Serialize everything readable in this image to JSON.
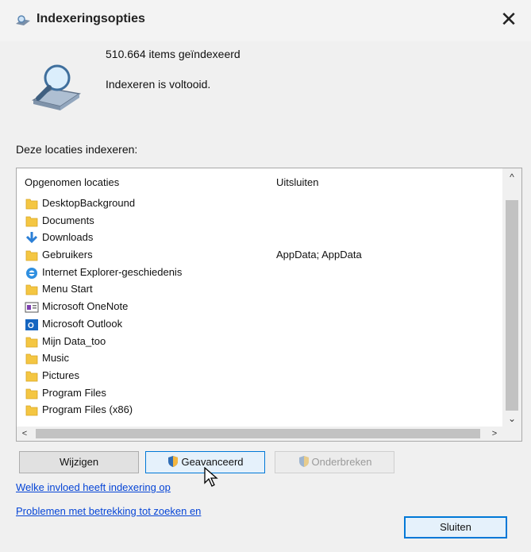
{
  "window": {
    "title": "Indexeringsopties",
    "close_glyph": "✕"
  },
  "summary": {
    "items_indexed": "510.664 items geïndexeerd",
    "status": "Indexeren is voltooid."
  },
  "locations_label": "Deze locaties indexeren:",
  "table": {
    "columns": [
      "Opgenomen locaties",
      "Uitsluiten"
    ],
    "rows": [
      {
        "name": "DesktopBackground",
        "exclude": "",
        "icon": "folder-icon"
      },
      {
        "name": "Documents",
        "exclude": "",
        "icon": "folder-icon"
      },
      {
        "name": "Downloads",
        "exclude": "",
        "icon": "download-arrow-icon"
      },
      {
        "name": "Gebruikers",
        "exclude": "AppData; AppData",
        "icon": "folder-icon"
      },
      {
        "name": "Internet Explorer-geschiedenis",
        "exclude": "",
        "icon": "internet-explorer-icon"
      },
      {
        "name": "Menu Start",
        "exclude": "",
        "icon": "folder-icon"
      },
      {
        "name": "Microsoft OneNote",
        "exclude": "",
        "icon": "onenote-icon"
      },
      {
        "name": "Microsoft Outlook",
        "exclude": "",
        "icon": "outlook-icon"
      },
      {
        "name": "Mijn Data_too",
        "exclude": "",
        "icon": "folder-icon"
      },
      {
        "name": "Music",
        "exclude": "",
        "icon": "folder-icon"
      },
      {
        "name": "Pictures",
        "exclude": "",
        "icon": "folder-icon"
      },
      {
        "name": "Program Files",
        "exclude": "",
        "icon": "folder-icon"
      },
      {
        "name": "Program Files (x86)",
        "exclude": "",
        "icon": "folder-icon"
      }
    ]
  },
  "scroll_glyphs": {
    "up": "^",
    "down": "⌄",
    "left": "<",
    "right": ">"
  },
  "buttons": {
    "modify": "Wijzigen",
    "advanced": "Geavanceerd",
    "pause": "Onderbreken",
    "close": "Sluiten"
  },
  "links": {
    "influence": "Welke invloed heeft indexering op",
    "troubleshoot": "Problemen met betrekking tot zoeken en"
  },
  "colors": {
    "accent": "#0078d7",
    "folder": "#f4c642",
    "link": "#0645d6",
    "disabled_text": "#9a9a9a"
  }
}
